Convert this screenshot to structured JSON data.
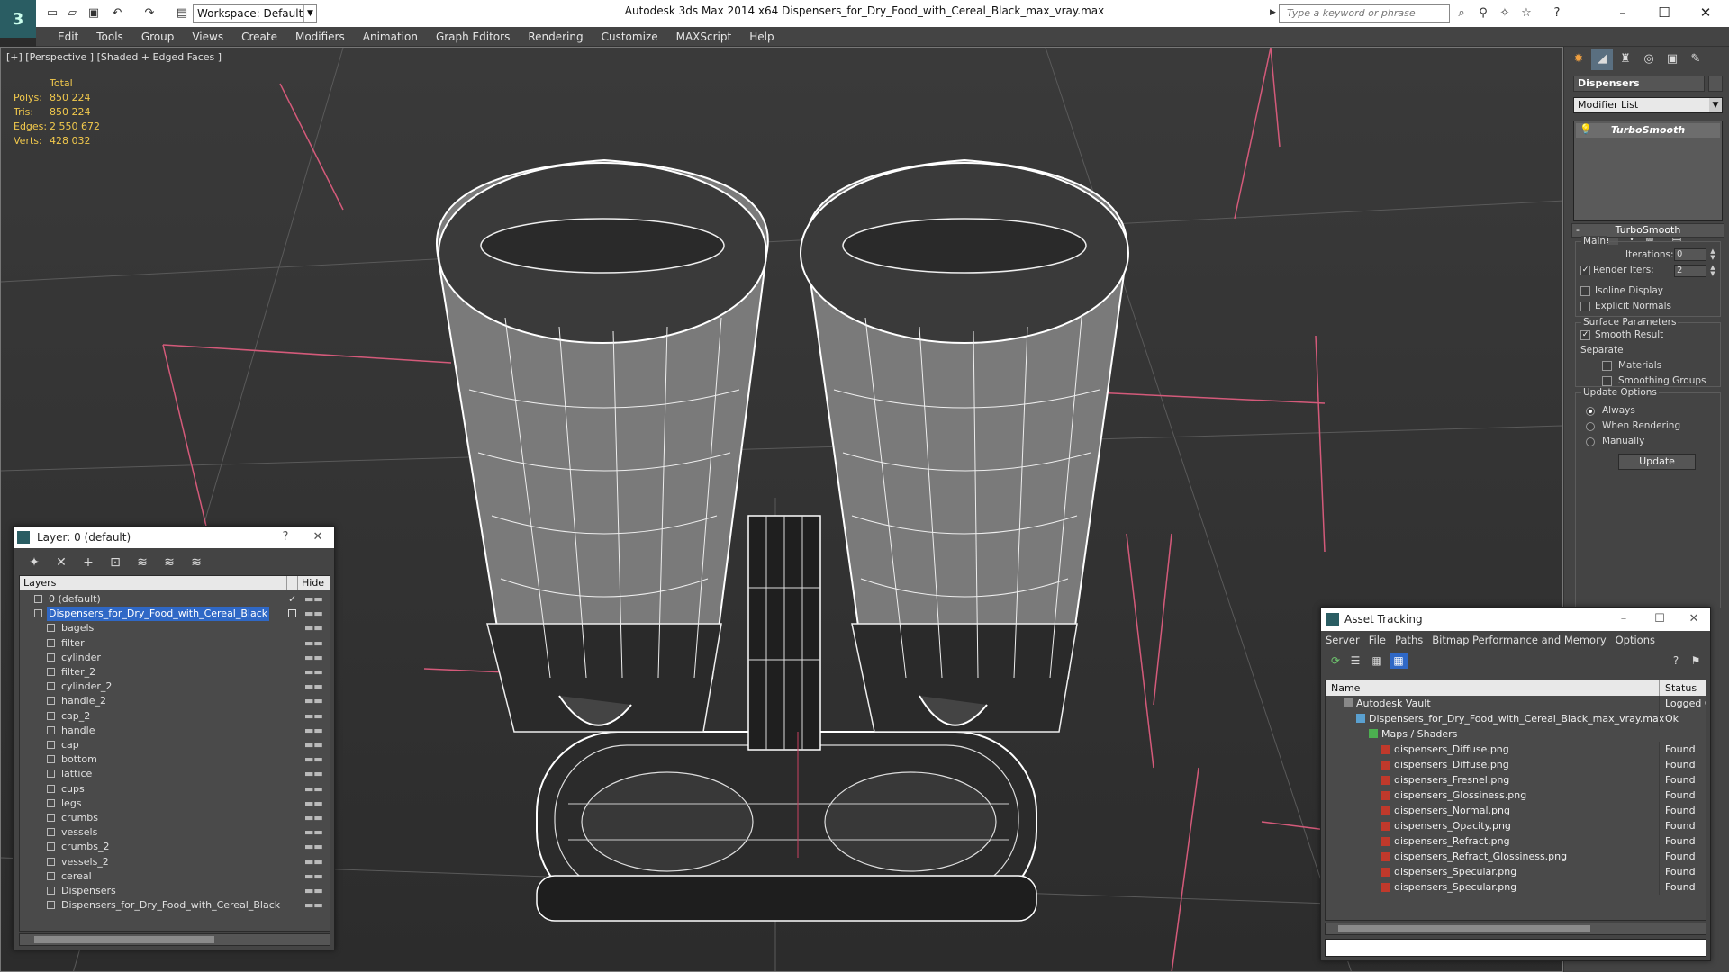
{
  "app": {
    "logo_text": "3",
    "window_title": "Autodesk 3ds Max 2014 x64     Dispensers_for_Dry_Food_with_Cereal_Black_max_vray.max",
    "workspace_label": "Workspace: Default",
    "search_placeholder": "Type a keyword or phrase"
  },
  "menu": [
    "Edit",
    "Tools",
    "Group",
    "Views",
    "Create",
    "Modifiers",
    "Animation",
    "Graph Editors",
    "Rendering",
    "Customize",
    "MAXScript",
    "Help"
  ],
  "viewport": {
    "label": "[+] [Perspective ] [Shaded + Edged Faces ]",
    "stats": {
      "header": "Total",
      "rows": [
        {
          "k": "Polys:",
          "v": "850 224"
        },
        {
          "k": "Tris:",
          "v": "850 224"
        },
        {
          "k": "Edges:",
          "v": "2 550 672"
        },
        {
          "k": "Verts:",
          "v": "428 032"
        }
      ]
    }
  },
  "command_panel": {
    "object_name": "Dispensers",
    "modifier_list": "Modifier List",
    "stack_item": "TurboSmooth",
    "rollout_title": "TurboSmooth",
    "main_group": "Main",
    "iterations_label": "Iterations:",
    "iterations_value": "0",
    "render_iters_label": "Render Iters:",
    "render_iters_value": "2",
    "render_iters_checked": "✓",
    "isoline_label": "Isoline Display",
    "explicit_normals_label": "Explicit Normals",
    "surface_group": "Surface Parameters",
    "smooth_result_label": "Smooth Result",
    "smooth_result_checked": "✓",
    "separate_label": "Separate",
    "materials_label": "Materials",
    "smoothing_groups_label": "Smoothing Groups",
    "update_group": "Update Options",
    "always_label": "Always",
    "when_rendering_label": "When Rendering",
    "manually_label": "Manually",
    "update_button": "Update"
  },
  "layer_dialog": {
    "title": "Layer: 0 (default)",
    "help": "?",
    "close": "✕",
    "col_layers": "Layers",
    "col_hide": "Hide",
    "rows": [
      {
        "name": "0 (default)",
        "level": 1,
        "checked": "✓",
        "selected": false
      },
      {
        "name": "Dispensers_for_Dry_Food_with_Cereal_Black",
        "level": 1,
        "checked": "",
        "selected": true
      },
      {
        "name": "bagels",
        "level": 2
      },
      {
        "name": "filter",
        "level": 2
      },
      {
        "name": "cylinder",
        "level": 2
      },
      {
        "name": "filter_2",
        "level": 2
      },
      {
        "name": "cylinder_2",
        "level": 2
      },
      {
        "name": "handle_2",
        "level": 2
      },
      {
        "name": "cap_2",
        "level": 2
      },
      {
        "name": "handle",
        "level": 2
      },
      {
        "name": "cap",
        "level": 2
      },
      {
        "name": "bottom",
        "level": 2
      },
      {
        "name": "lattice",
        "level": 2
      },
      {
        "name": "cups",
        "level": 2
      },
      {
        "name": "legs",
        "level": 2
      },
      {
        "name": "crumbs",
        "level": 2
      },
      {
        "name": "vessels",
        "level": 2
      },
      {
        "name": "crumbs_2",
        "level": 2
      },
      {
        "name": "vessels_2",
        "level": 2
      },
      {
        "name": "cereal",
        "level": 2
      },
      {
        "name": "Dispensers",
        "level": 2
      },
      {
        "name": "Dispensers_for_Dry_Food_with_Cereal_Black",
        "level": 2
      }
    ],
    "hide_mark": "▬▬"
  },
  "asset_dialog": {
    "title": "Asset Tracking",
    "menu": [
      "Server",
      "File",
      "Paths",
      "Bitmap Performance and Memory",
      "Options"
    ],
    "col_name": "Name",
    "col_status": "Status",
    "rows": [
      {
        "name": "Autodesk Vault",
        "status": "Logged O",
        "indent": 1,
        "icon": "vault"
      },
      {
        "name": "Dispensers_for_Dry_Food_with_Cereal_Black_max_vray.max",
        "status": "Ok",
        "indent": 2,
        "icon": "max"
      },
      {
        "name": "Maps / Shaders",
        "status": "",
        "indent": 3,
        "icon": "maps"
      },
      {
        "name": "dispensers_Diffuse.png",
        "status": "Found",
        "indent": 4,
        "icon": "png"
      },
      {
        "name": "dispensers_Diffuse.png",
        "status": "Found",
        "indent": 4,
        "icon": "png"
      },
      {
        "name": "dispensers_Fresnel.png",
        "status": "Found",
        "indent": 4,
        "icon": "png"
      },
      {
        "name": "dispensers_Glossiness.png",
        "status": "Found",
        "indent": 4,
        "icon": "png"
      },
      {
        "name": "dispensers_Normal.png",
        "status": "Found",
        "indent": 4,
        "icon": "png"
      },
      {
        "name": "dispensers_Opacity.png",
        "status": "Found",
        "indent": 4,
        "icon": "png"
      },
      {
        "name": "dispensers_Refract.png",
        "status": "Found",
        "indent": 4,
        "icon": "png"
      },
      {
        "name": "dispensers_Refract_Glossiness.png",
        "status": "Found",
        "indent": 4,
        "icon": "png"
      },
      {
        "name": "dispensers_Specular.png",
        "status": "Found",
        "indent": 4,
        "icon": "png"
      },
      {
        "name": "dispensers_Specular.png",
        "status": "Found",
        "indent": 4,
        "icon": "png"
      }
    ]
  },
  "colors": {
    "selection": "#2f68c6",
    "stats_text": "#f2c94c",
    "grid_line": "#d45a7a",
    "app_icon": "#2a5d63"
  }
}
